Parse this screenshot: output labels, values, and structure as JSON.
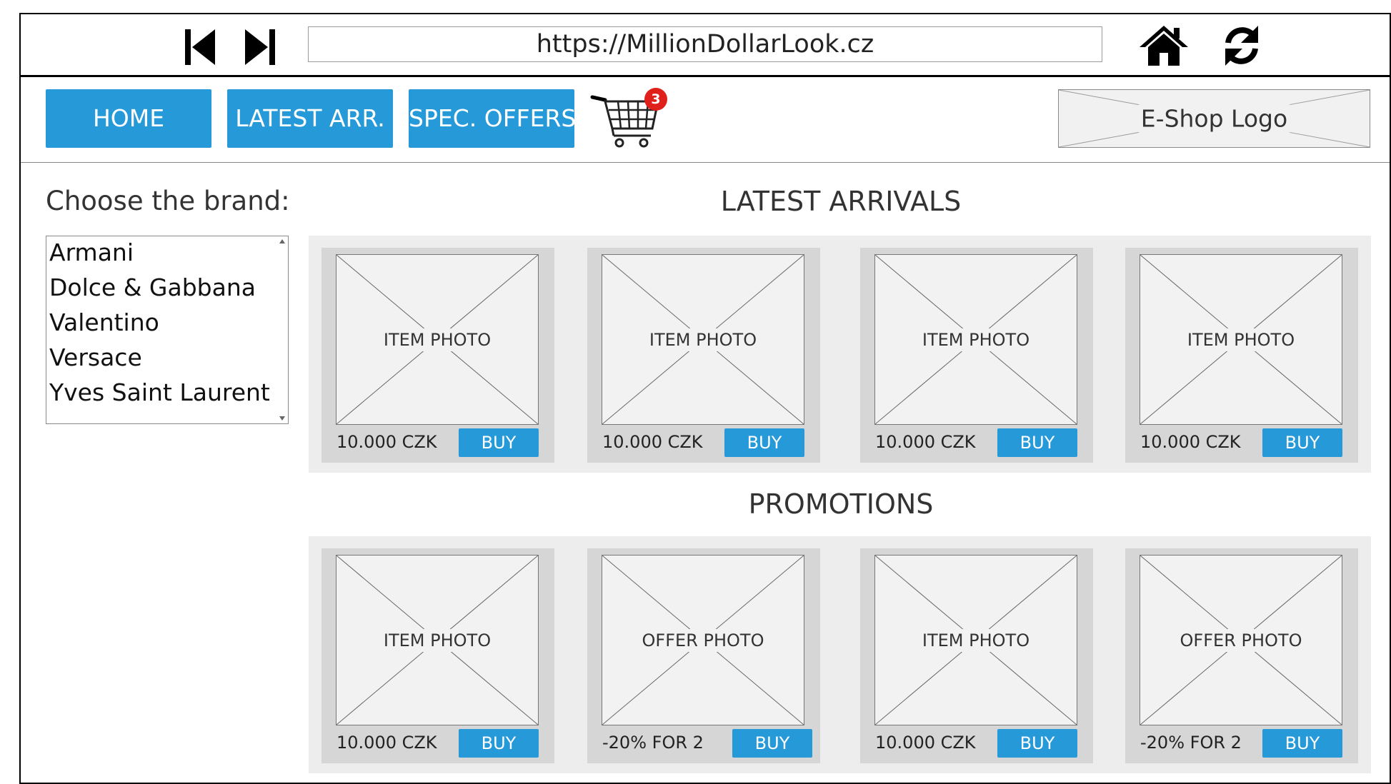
{
  "browser": {
    "url": "https://MillionDollarLook.cz",
    "icons": {
      "back": "skip-back-icon",
      "forward": "skip-forward-icon",
      "home": "home-icon",
      "reload": "reload-icon"
    }
  },
  "header": {
    "menu": {
      "home": "HOME",
      "latest": "LATEST ARR.",
      "offers": "SPEC. OFFERS"
    },
    "cart": {
      "icon": "shopping-cart-icon",
      "count": "3"
    },
    "logo": "E-Shop Logo"
  },
  "sidebar": {
    "title": "Choose the brand:",
    "brands": [
      "Armani",
      "Dolce & Gabbana",
      "Valentino",
      "Versace",
      "Yves Saint Laurent"
    ]
  },
  "latest": {
    "title": "LATEST ARRIVALS",
    "items": [
      {
        "photo": "ITEM PHOTO",
        "price": "10.000 CZK",
        "buy": "BUY"
      },
      {
        "photo": "ITEM PHOTO",
        "price": "10.000 CZK",
        "buy": "BUY"
      },
      {
        "photo": "ITEM PHOTO",
        "price": "10.000 CZK",
        "buy": "BUY"
      },
      {
        "photo": "ITEM PHOTO",
        "price": "10.000 CZK",
        "buy": "BUY"
      }
    ]
  },
  "promotions": {
    "title": "PROMOTIONS",
    "items": [
      {
        "photo": "ITEM PHOTO",
        "price": "10.000 CZK",
        "buy": "BUY"
      },
      {
        "photo": "OFFER PHOTO",
        "price": "-20% FOR 2",
        "buy": "BUY"
      },
      {
        "photo": "ITEM PHOTO",
        "price": "10.000 CZK",
        "buy": "BUY"
      },
      {
        "photo": "OFFER PHOTO",
        "price": "-20% FOR 2",
        "buy": "BUY"
      }
    ]
  },
  "colors": {
    "accent": "#2699d9",
    "badge": "#e0201b",
    "panel": "#ededed",
    "card": "#d6d6d6",
    "placeholder": "#f2f2f2"
  }
}
